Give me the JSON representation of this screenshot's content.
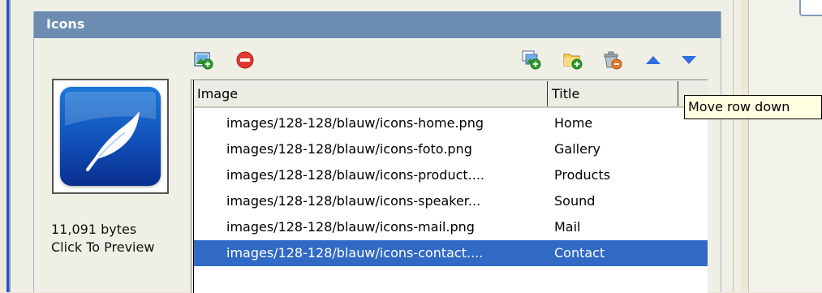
{
  "panel": {
    "title": "Icons"
  },
  "toolbar": {
    "left_icons": [
      "add-image-icon",
      "remove-icon"
    ],
    "right_icons": [
      "add-multiple-images-icon",
      "add-folder-icon",
      "clear-all-icon",
      "move-row-up-icon",
      "move-row-down-icon"
    ]
  },
  "preview": {
    "icon": "feather-icon",
    "size_text": "11,091 bytes",
    "click_text": "Click To Preview"
  },
  "grid": {
    "columns": [
      "Image",
      "Title",
      ""
    ],
    "rows": [
      {
        "image": "images/128-128/blauw/icons-home.png",
        "title": "Home"
      },
      {
        "image": "images/128-128/blauw/icons-foto.png",
        "title": "Gallery"
      },
      {
        "image": "images/128-128/blauw/icons-product....",
        "title": "Products"
      },
      {
        "image": "images/128-128/blauw/icons-speaker...",
        "title": "Sound"
      },
      {
        "image": "images/128-128/blauw/icons-mail.png",
        "title": "Mail"
      },
      {
        "image": "images/128-128/blauw/icons-contact....",
        "title": "Contact",
        "selected": true
      }
    ]
  },
  "tooltip": {
    "text": "Move row down"
  },
  "colors": {
    "header_bg": "#6c8cb2",
    "selection": "#316ac5",
    "tooltip_bg": "#ffffe1",
    "arrow_blue": "#2f6fe0",
    "remove_red": "#e03a2e"
  }
}
